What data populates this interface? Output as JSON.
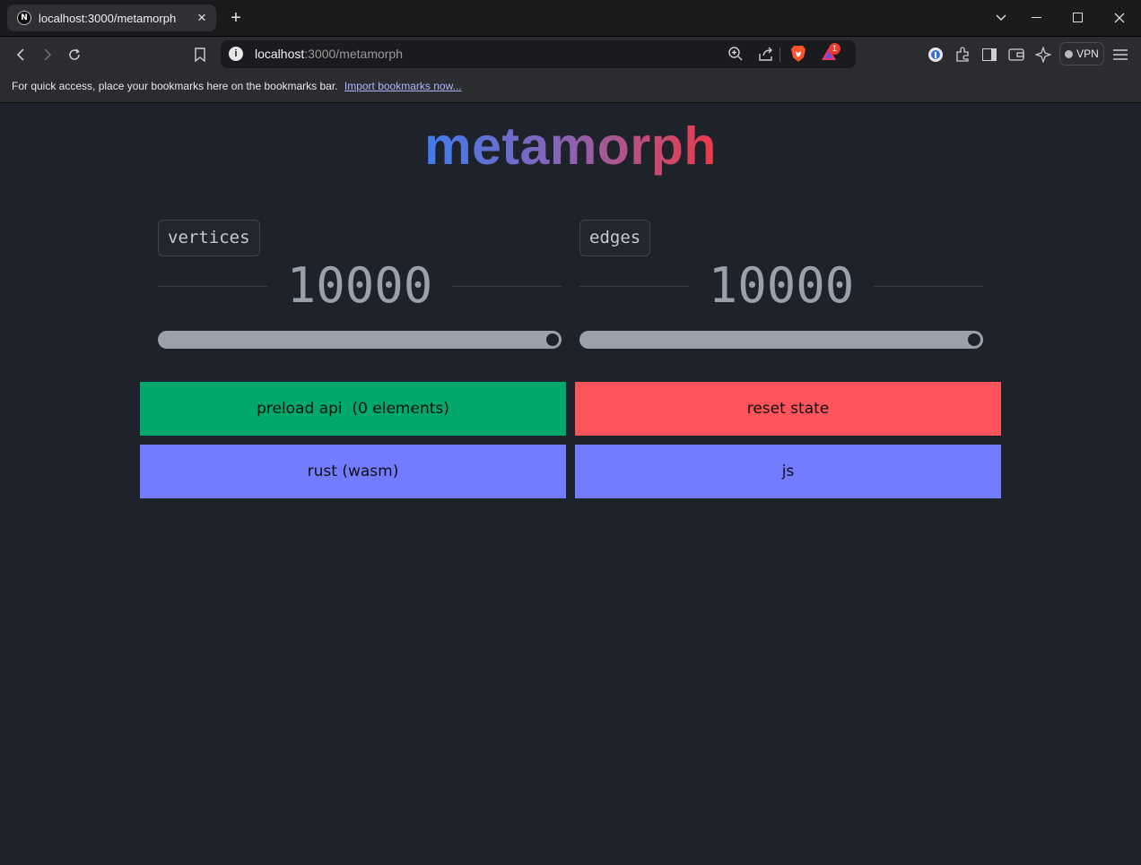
{
  "browser": {
    "tab": {
      "title": "localhost:3000/metamorph",
      "favicon": "N"
    },
    "url": {
      "host": "localhost",
      "path": ":3000/metamorph"
    },
    "vpn_label": "VPN",
    "notification_count": "1",
    "bookmarks_bar": {
      "message": "For quick access, place your bookmarks here on the bookmarks bar.",
      "link": "Import bookmarks now..."
    }
  },
  "page": {
    "title": "metamorph",
    "controls": [
      {
        "label": "vertices",
        "value": "10000",
        "slider_fraction": 1.0
      },
      {
        "label": "edges",
        "value": "10000",
        "slider_fraction": 1.0
      }
    ],
    "buttons": {
      "preload": "preload api  (0 elements)",
      "reset": "reset state",
      "rust": "rust (wasm)",
      "js": "js"
    }
  },
  "colors": {
    "background": "#1e222a",
    "preload_button": "#00a86b",
    "reset_button": "#ff545c",
    "run_button": "#737cff",
    "title_gradient": [
      "#3f7cf0",
      "#8d62b0",
      "#ee3a48"
    ]
  }
}
